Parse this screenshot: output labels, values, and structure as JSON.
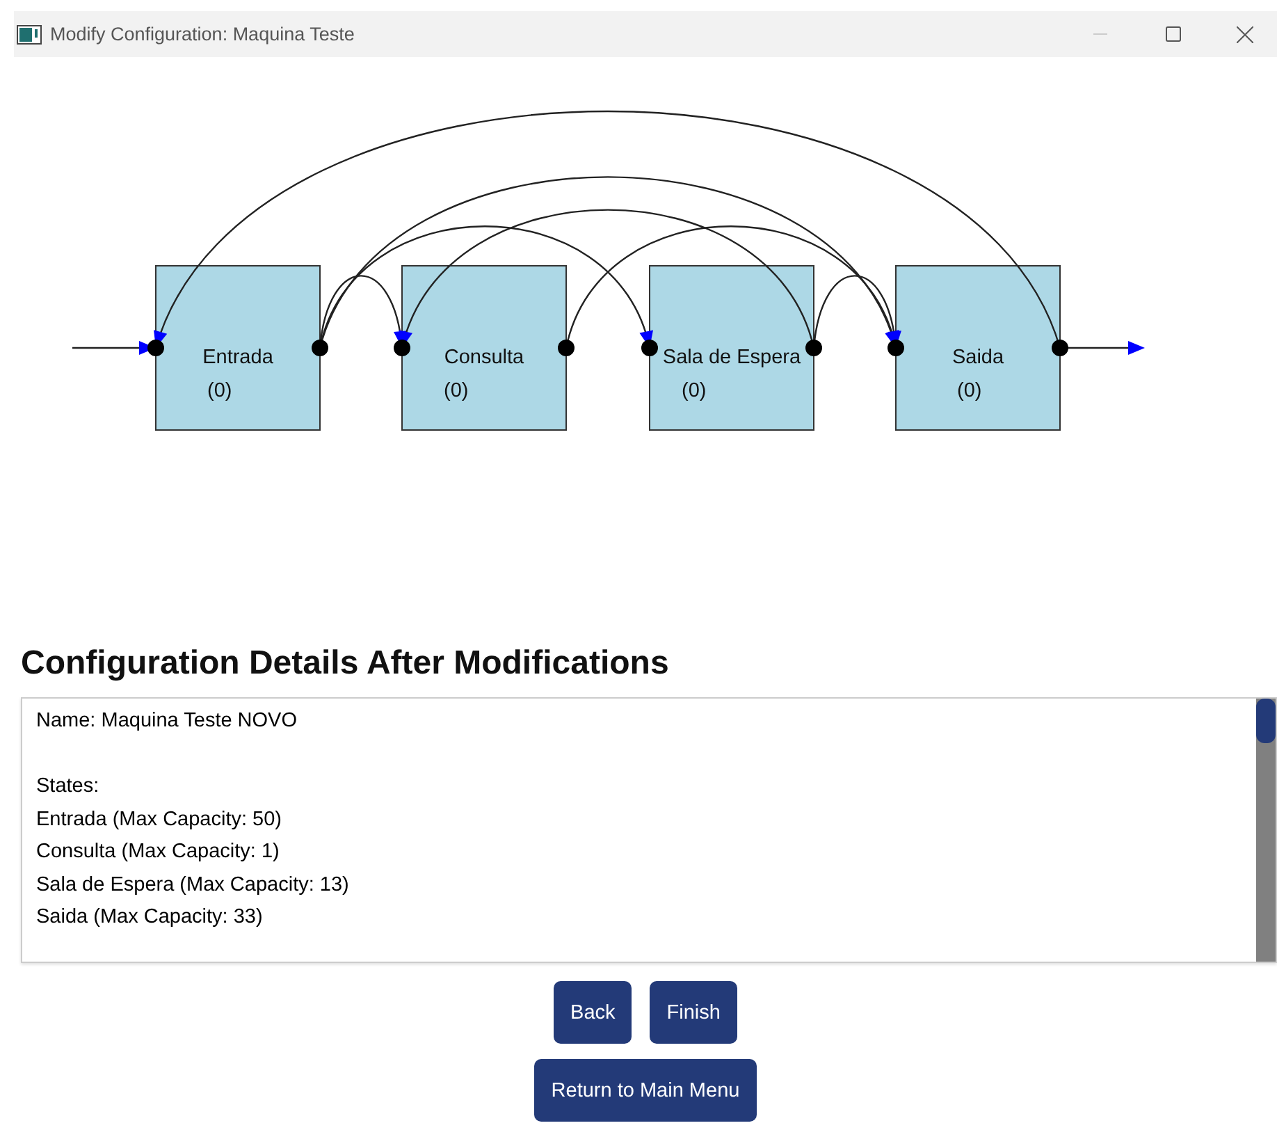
{
  "window": {
    "title": "Modify Configuration: Maquina Teste"
  },
  "diagram": {
    "states": [
      {
        "label": "Entrada",
        "count": "(0)"
      },
      {
        "label": "Consulta",
        "count": "(0)"
      },
      {
        "label": "Sala de Espera",
        "count": "(0)"
      },
      {
        "label": "Saida",
        "count": "(0)"
      }
    ]
  },
  "heading": "Configuration Details After Modifications",
  "details": {
    "name_line": "Name: Maquina Teste NOVO",
    "states_heading": "States:",
    "states": [
      "Entrada (Max Capacity: 50)",
      "Consulta (Max Capacity: 1)",
      "Sala de Espera (Max Capacity: 13)",
      "Saida (Max Capacity: 33)"
    ]
  },
  "buttons": [
    "Back",
    "Finish"
  ],
  "main_menu_button": "Return to Main Menu"
}
